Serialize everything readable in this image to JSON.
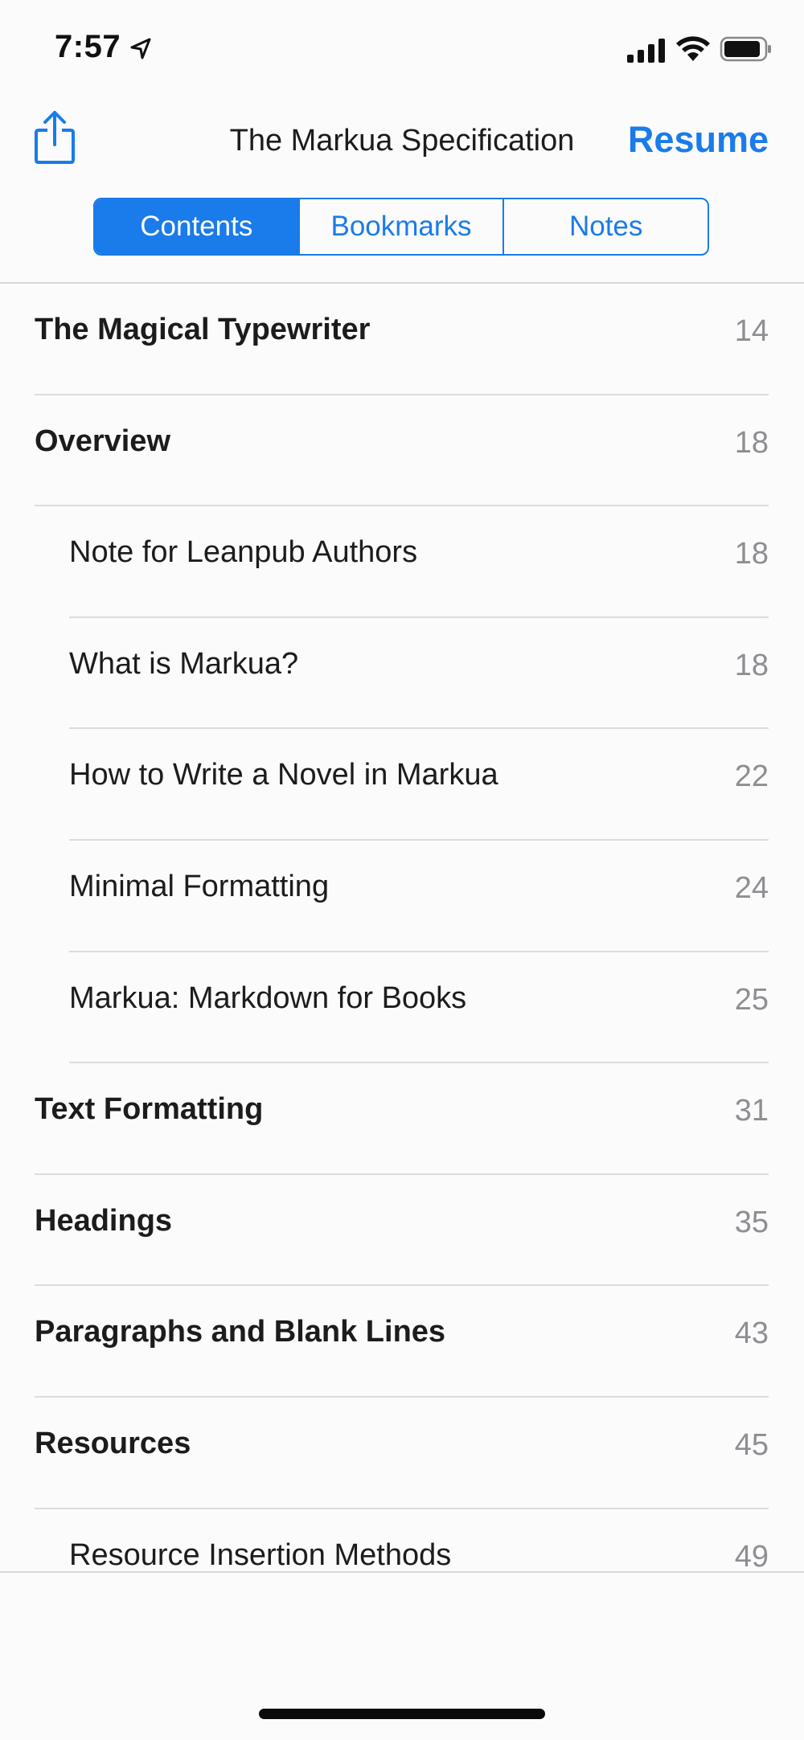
{
  "status_bar": {
    "time": "7:57",
    "icons": [
      "location-arrow-icon",
      "cellular-signal-icon",
      "wifi-icon",
      "battery-icon"
    ]
  },
  "nav": {
    "title": "The Markua Specification",
    "share_icon": "share-icon",
    "resume_label": "Resume"
  },
  "tabs": [
    {
      "label": "Contents",
      "active": true
    },
    {
      "label": "Bookmarks",
      "active": false
    },
    {
      "label": "Notes",
      "active": false
    }
  ],
  "contents": [
    {
      "title": "The Magical Typewriter",
      "page": "14",
      "level": 1
    },
    {
      "title": "Overview",
      "page": "18",
      "level": 1
    },
    {
      "title": "Note for Leanpub Authors",
      "page": "18",
      "level": 2
    },
    {
      "title": "What is Markua?",
      "page": "18",
      "level": 2
    },
    {
      "title": "How to Write a Novel in Markua",
      "page": "22",
      "level": 2
    },
    {
      "title": "Minimal Formatting",
      "page": "24",
      "level": 2
    },
    {
      "title": "Markua: Markdown for Books",
      "page": "25",
      "level": 2
    },
    {
      "title": "Text Formatting",
      "page": "31",
      "level": 1
    },
    {
      "title": "Headings",
      "page": "35",
      "level": 1
    },
    {
      "title": "Paragraphs and Blank Lines",
      "page": "43",
      "level": 1
    },
    {
      "title": "Resources",
      "page": "45",
      "level": 1
    },
    {
      "title": "Resource Insertion Methods",
      "page": "49",
      "level": 2
    }
  ],
  "colors": {
    "accent": "#1a7bea",
    "page_number": "#8e8e93",
    "background": "#fbfbfb"
  }
}
